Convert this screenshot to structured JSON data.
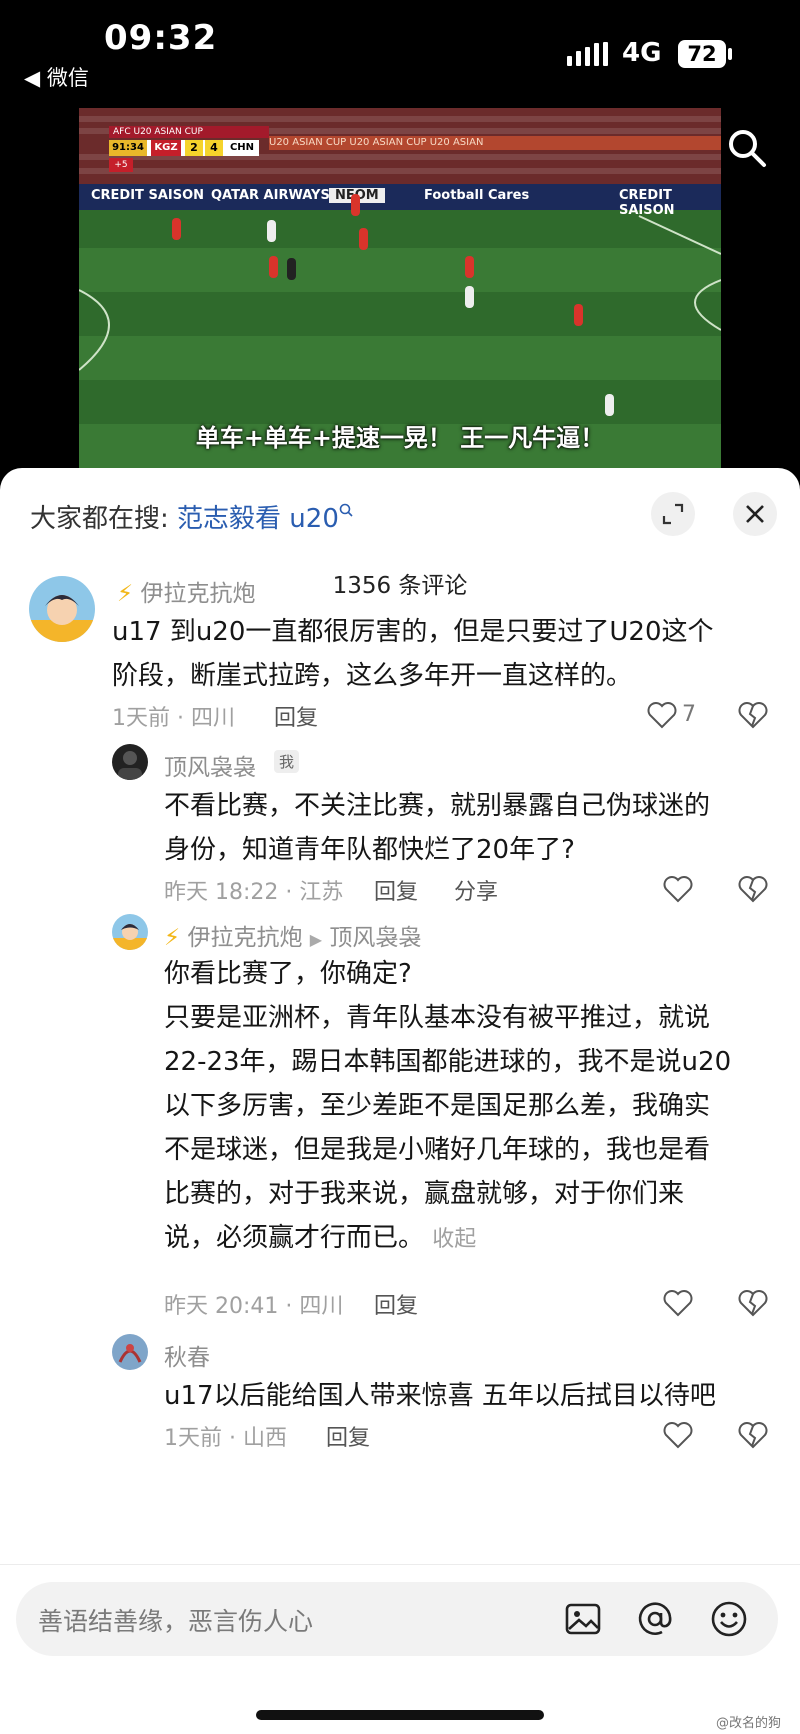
{
  "status": {
    "time": "09:32",
    "back_app": "◀ 微信",
    "network": "4G",
    "battery": "72"
  },
  "video": {
    "caption": "单车+单车+提速一晃！ 王一凡牛逼！",
    "scoreboard": {
      "league": "AFC U20 ASIAN CUP",
      "clock": "91:34",
      "team1": "KGZ",
      "score1": "2",
      "score2": "4",
      "team2": "CHN",
      "added": "+5"
    },
    "ads": [
      "CREDIT SAISON",
      "QATAR AIRWAYS",
      "NEOM",
      "Football Cares",
      "CREDIT SAISON"
    ],
    "upper_board": "U20 ASIAN CUP   U20 ASIAN CUP   U20 ASIAN"
  },
  "sheet": {
    "hot_prefix": "大家都在搜:",
    "hot_link": "范志毅看 u20",
    "comment_count": "1356 条评论"
  },
  "comments": [
    {
      "user": "伊拉克抗炮",
      "text_lines": [
        "u17  到u20一直都很厉害的，但是只要过了U20这个",
        "阶段，断崖式拉跨，这么多年开一直这样的。"
      ],
      "meta": "1天前 · 四川",
      "reply": "回复",
      "likes": "7"
    },
    {
      "user": "顶风袅袅",
      "tag": "我",
      "text_lines": [
        "不看比赛，不关注比赛，就别暴露自己伪球迷的",
        "身份，知道青年队都快烂了20年了?"
      ],
      "meta": "昨天 18:22 · 江苏",
      "reply": "回复",
      "share": "分享"
    },
    {
      "user": "伊拉克抗炮",
      "reply_to": "顶风袅袅",
      "text_lines": [
        "你看比赛了，你确定?",
        "只要是亚洲杯，青年队基本没有被平推过，就说",
        "22-23年，踢日本韩国都能进球的，我不是说u20",
        "以下多厉害，至少差距不是国足那么差，我确实",
        "不是球迷，但是我是小赌好几年球的，我也是看",
        "比赛的，对于我来说，赢盘就够，对于你们来",
        "说，必须赢才行而已。"
      ],
      "fold": "收起",
      "meta": "昨天 20:41 · 四川",
      "reply": "回复"
    },
    {
      "user": "秋春",
      "text_lines": [
        "u17以后能给国人带来惊喜 五年以后拭目以待吧"
      ],
      "meta": "1天前 · 山西",
      "reply": "回复"
    }
  ],
  "input": {
    "placeholder": "善语结善缘，恶言伤人心"
  },
  "watermark": "@改名的狗",
  "colors": {
    "link": "#2a5db0",
    "bolt": "#f2b718",
    "meta": "#a0a0a0"
  }
}
